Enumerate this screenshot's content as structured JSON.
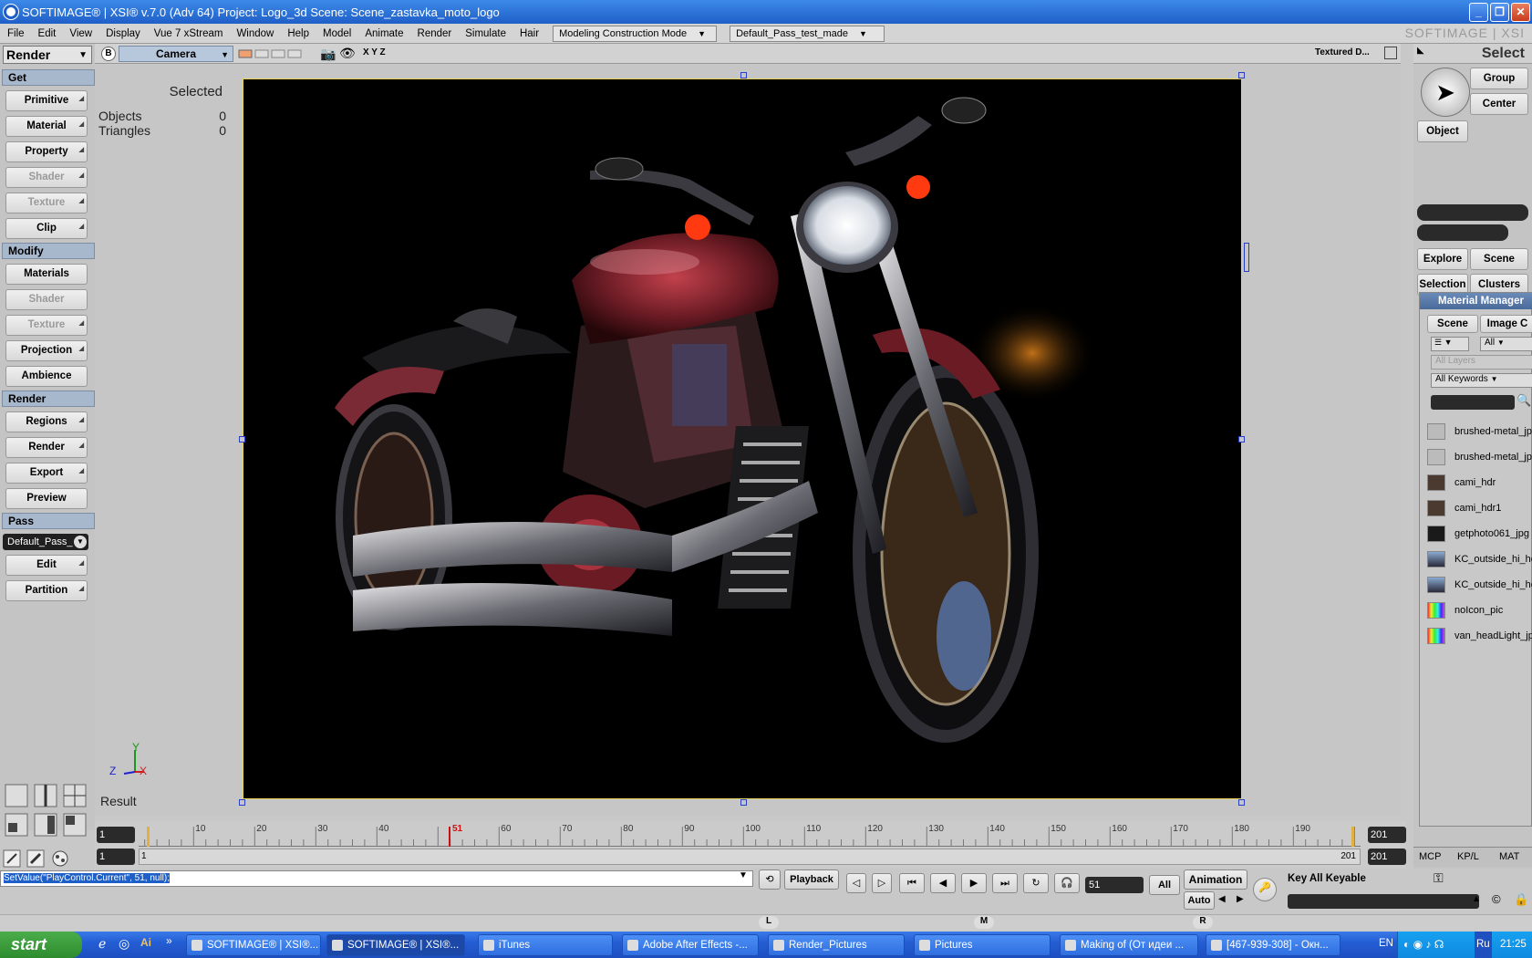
{
  "window": {
    "title": "SOFTIMAGE® | XSI® v.7.0 (Adv 64) Project: Logo_3d     Scene: Scene_zastavka_moto_logo"
  },
  "menu": [
    "File",
    "Edit",
    "View",
    "Display",
    "Vue 7 xStream",
    "Window",
    "Help",
    "Model",
    "Animate",
    "Render",
    "Simulate",
    "Hair"
  ],
  "mode_combo": "Modeling Construction Mode",
  "pass_combo": "Default_Pass_test_made",
  "brand": "SOFTIMAGE | XSI",
  "left": {
    "module": "Render",
    "get_header": "Get",
    "get_items": [
      {
        "label": "Primitive",
        "enabled": true
      },
      {
        "label": "Material",
        "enabled": true
      },
      {
        "label": "Property",
        "enabled": true
      },
      {
        "label": "Shader",
        "enabled": false
      },
      {
        "label": "Texture",
        "enabled": false
      },
      {
        "label": "Clip",
        "enabled": true
      }
    ],
    "modify_header": "Modify",
    "modify_items": [
      {
        "label": "Materials",
        "enabled": true
      },
      {
        "label": "Shader",
        "enabled": false
      },
      {
        "label": "Texture",
        "enabled": false
      },
      {
        "label": "Projection",
        "enabled": true
      },
      {
        "label": "Ambience",
        "enabled": true
      }
    ],
    "render_header": "Render",
    "render_items": [
      {
        "label": "Regions",
        "enabled": true
      },
      {
        "label": "Render",
        "enabled": true
      },
      {
        "label": "Export",
        "enabled": true
      },
      {
        "label": "Preview",
        "enabled": true
      }
    ],
    "pass_header": "Pass",
    "pass_value": "Default_Pass_",
    "pass_items": [
      {
        "label": "Edit",
        "enabled": true
      },
      {
        "label": "Partition",
        "enabled": true
      }
    ]
  },
  "viewport": {
    "badge": "B",
    "camera": "Camera",
    "axes": "X Y Z",
    "shading": "Textured D...",
    "selected_label": "Selected",
    "objects_label": "Objects",
    "objects_value": "0",
    "triangles_label": "Triangles",
    "triangles_value": "0",
    "result_label": "Result",
    "axis_x": "X",
    "axis_y": "Y",
    "axis_z": "Z"
  },
  "timeline": {
    "start": "1",
    "end": "201",
    "current": "51",
    "ticks": [
      "10",
      "20",
      "30",
      "40",
      "60",
      "70",
      "80",
      "90",
      "100",
      "110",
      "120",
      "130",
      "140",
      "150",
      "160",
      "170",
      "180",
      "190"
    ],
    "range_start": "1",
    "range_start2": "1",
    "range_end": "201",
    "range_end2": "201"
  },
  "bottom": {
    "command": "SetValue(\"PlayControl.Current\", 51, null);",
    "playback": "Playback",
    "frame": "51",
    "all": "All",
    "animation": "Animation",
    "auto": "Auto",
    "key_all": "Key All Keyable",
    "markers": [
      "L",
      "M",
      "R"
    ]
  },
  "right": {
    "select": "Select",
    "group": "Group",
    "center": "Center",
    "object": "Object",
    "explore": "Explore",
    "scene": "Scene",
    "selection": "Selection",
    "clusters": "Clusters",
    "mm_title": "Material Manager",
    "mm_tab_scene": "Scene",
    "mm_tab_image": "Image C",
    "filter_all": "All",
    "all_layers": "All Layers",
    "all_keywords": "All Keywords",
    "images": [
      "brushed-metal_jp",
      "brushed-metal_jp",
      "cami_hdr",
      "cami_hdr1",
      "getphoto061_jpg",
      "KC_outside_hi_hc",
      "KC_outside_hi_hc",
      "noIcon_pic",
      "van_headLight_jp"
    ],
    "tabs": [
      "MCP",
      "KP/L",
      "MAT"
    ]
  },
  "taskbar": {
    "start": "start",
    "tasks": [
      "SOFTIMAGE® | XSI®...",
      "SOFTIMAGE® | XSI®...",
      "iTunes",
      "Adobe After Effects -...",
      "Render_Pictures",
      "Pictures",
      "Making of (От идеи ...",
      "[467-939-308] - Окн..."
    ],
    "lang": "EN",
    "lang2": "Ru",
    "clock": "21:25"
  }
}
